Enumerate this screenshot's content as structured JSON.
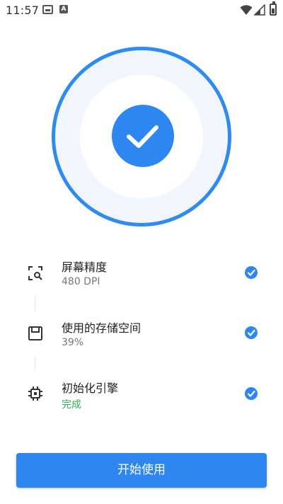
{
  "status_bar": {
    "time": "11:57",
    "left_icons": [
      "image-icon",
      "a-icon"
    ],
    "a_icon_letter": "A",
    "right_icons": [
      "wifi-icon",
      "signal-icon",
      "battery-icon"
    ]
  },
  "hero": {
    "icon": "check-icon",
    "accent_color": "#2e87f0"
  },
  "items": [
    {
      "icon": "screen-scan-icon",
      "title": "屏幕精度",
      "subtitle": "480 DPI",
      "status_icon": "check-circle-icon"
    },
    {
      "icon": "storage-icon",
      "title": "使用的存储空间",
      "subtitle": "39%",
      "status_icon": "check-circle-icon"
    },
    {
      "icon": "chip-icon",
      "title": "初始化引擎",
      "subtitle": "完成",
      "status_icon": "check-circle-icon",
      "subtitle_color": "#2fae55"
    }
  ],
  "start_button": {
    "label": "开始使用"
  }
}
